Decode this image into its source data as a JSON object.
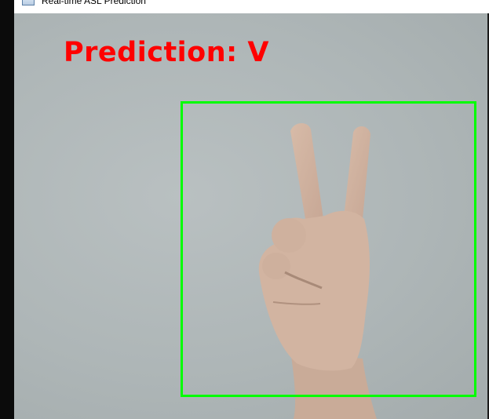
{
  "window": {
    "title": "Real-time ASL Prediction",
    "icon": "app-window-icon"
  },
  "overlay": {
    "prediction_text": "Prediction: V",
    "text_color": "#ff0000",
    "roi_color": "#00ff00"
  },
  "feed": {
    "subject": "hand-sign-v"
  }
}
